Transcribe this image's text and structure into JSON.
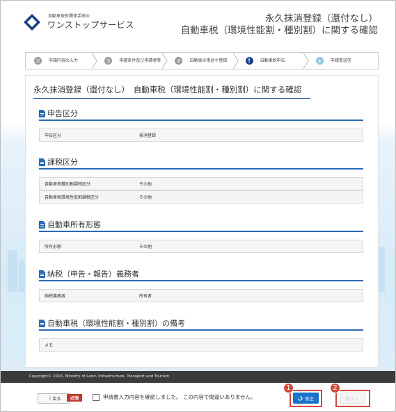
{
  "header": {
    "org": "自動車保有関係手続の",
    "brand": "ワンストップサービス",
    "title_line1": "永久抹消登録（還付なし）",
    "title_line2": "自動車税（環境性能割・種別割）に関する確認"
  },
  "steps": [
    {
      "num": "済",
      "label": "申請内容の入力",
      "state": "done"
    },
    {
      "num": "済",
      "label": "申請条件及び申請者等",
      "state": "done"
    },
    {
      "num": "済",
      "label": "自動車の用途や登録",
      "state": "done"
    },
    {
      "num": "!",
      "label": "自動車税申告",
      "state": "active"
    },
    {
      "num": "未",
      "label": "申請書送信",
      "state": "todo"
    }
  ],
  "page_title": "永久抹消登録（還付なし）　自動車税（環境性能割・種別割）に関する確認",
  "sections": {
    "declaration": {
      "heading": "申告区分",
      "rows": [
        {
          "k": "申告区分",
          "v": "抹消登録"
        }
      ]
    },
    "tax_class": {
      "heading": "課税区分",
      "rows": [
        {
          "k": "自動車税種別割課税区分",
          "v": "その他"
        },
        {
          "k": "自動車税環境性能割課税区分",
          "v": "その他"
        }
      ]
    },
    "ownership": {
      "heading": "自動車所有形態",
      "rows": [
        {
          "k": "所有形態",
          "v": "その他"
        }
      ]
    },
    "taxpayer": {
      "heading": "納税（申告・報告）義務者",
      "rows": [
        {
          "k": "納税義務者",
          "v": "所有者"
        }
      ]
    },
    "remarks": {
      "heading": "自動車税（環境性能割・種別割）の備考",
      "rows": [
        {
          "k": "メモ",
          "v": ""
        }
      ]
    }
  },
  "footer": {
    "copyright": "Copyright© 2016, Ministry of Land, Infrastructure, Transport and Tourism"
  },
  "actions": {
    "back_label": "〈 戻る",
    "required_label": "必須",
    "confirm_label": "申請書入力内容を確認しました。 この内容で間違いありません。",
    "fix_label": "修正",
    "next_label": "次へ 〉",
    "badge1": "1",
    "badge2": "2"
  },
  "colors": {
    "accent": "#1a73c9",
    "highlight": "#d04a3a",
    "section_line": "#2a6ab3"
  }
}
